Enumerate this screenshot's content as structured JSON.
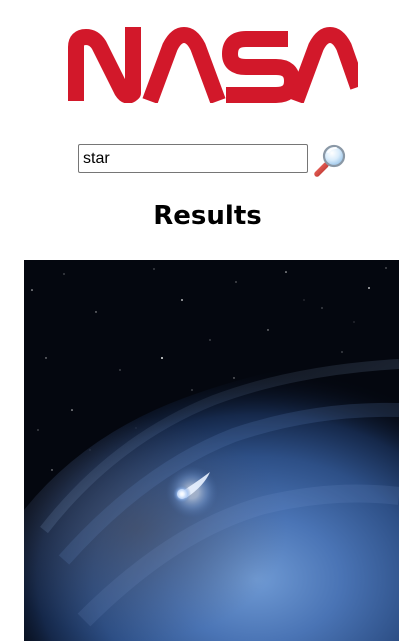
{
  "app": {
    "logo_text": "NASA",
    "logo_icon": "nasa-worm-logo-icon",
    "logo_color": "#d2182a"
  },
  "search": {
    "value": "star",
    "placeholder": "",
    "button_icon": "magnifying-glass-icon"
  },
  "results": {
    "heading": "Results",
    "items": [
      {
        "type": "image",
        "subject": "space-image",
        "colors": {
          "space": "#04070f",
          "nebula": "#4a74b5",
          "highlight": "#e9f2ff"
        }
      }
    ]
  }
}
